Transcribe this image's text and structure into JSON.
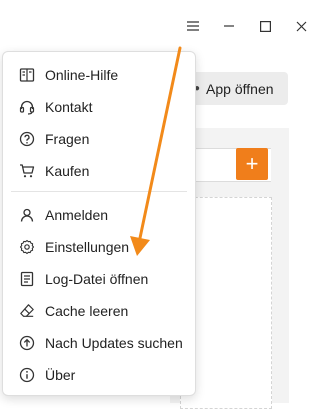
{
  "window": {
    "controls": [
      {
        "name": "hamburger-menu-icon"
      },
      {
        "name": "minimize-icon"
      },
      {
        "name": "maximize-icon"
      },
      {
        "name": "close-icon"
      }
    ]
  },
  "toolbar": {
    "app_open_label": "App öffnen"
  },
  "add_button": {
    "label": "+"
  },
  "menu": {
    "group1": [
      {
        "label": "Online-Hilfe",
        "icon": "book-icon"
      },
      {
        "label": "Kontakt",
        "icon": "headset-icon"
      },
      {
        "label": "Fragen",
        "icon": "question-icon"
      },
      {
        "label": "Kaufen",
        "icon": "cart-icon"
      }
    ],
    "group2": [
      {
        "label": "Anmelden",
        "icon": "user-icon"
      },
      {
        "label": "Einstellungen",
        "icon": "gear-icon"
      },
      {
        "label": "Log-Datei öffnen",
        "icon": "log-file-icon"
      },
      {
        "label": "Cache leeren",
        "icon": "eraser-icon"
      },
      {
        "label": "Nach Updates suchen",
        "icon": "upload-icon"
      },
      {
        "label": "Über",
        "icon": "info-icon"
      }
    ]
  },
  "colors": {
    "accent": "#f07e1b",
    "arrow": "#f28a1a"
  }
}
